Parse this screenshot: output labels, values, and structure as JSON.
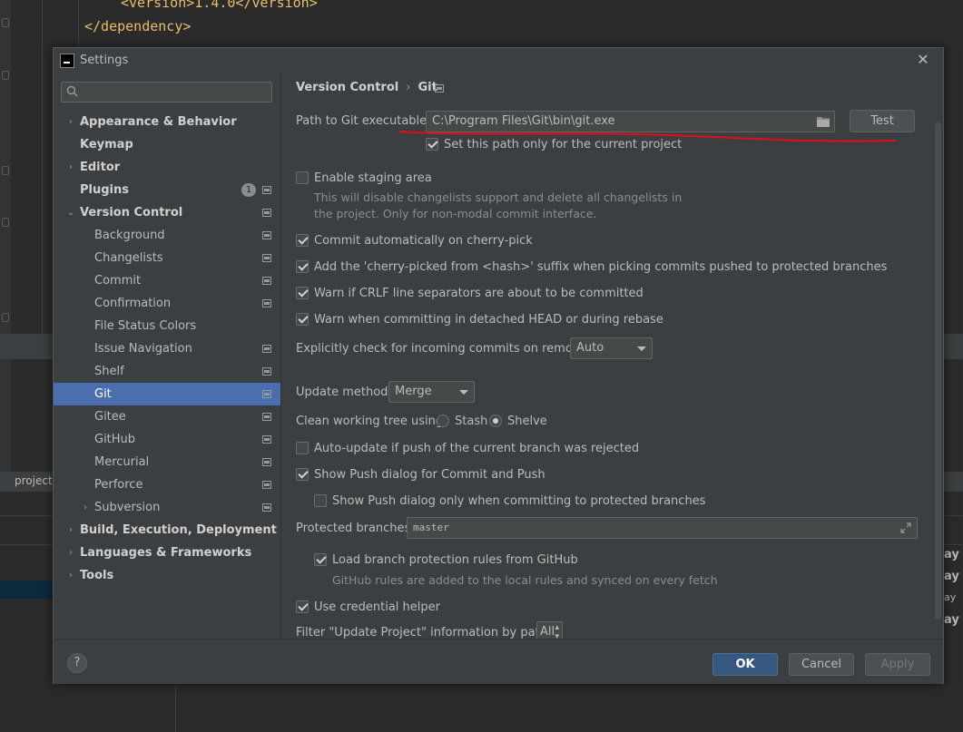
{
  "ide": {
    "code_line_1": "<version>1.4.0</version>",
    "code_line_2": "</dependency>",
    "project_tab": "project",
    "right_snippets": [
      "ay",
      "ay",
      "ay",
      "ay"
    ]
  },
  "dialog": {
    "title": "Settings",
    "close_glyph": "✕"
  },
  "sidebar": {
    "search_placeholder": "",
    "items": [
      {
        "label": "Appearance & Behavior",
        "level": "top",
        "arrow": "›"
      },
      {
        "label": "Keymap",
        "level": "top",
        "arrow": ""
      },
      {
        "label": "Editor",
        "level": "top",
        "arrow": "›"
      },
      {
        "label": "Plugins",
        "level": "top",
        "arrow": "",
        "badge": "1"
      },
      {
        "label": "Version Control",
        "level": "top",
        "arrow": "⌄"
      },
      {
        "label": "Background",
        "level": "sub"
      },
      {
        "label": "Changelists",
        "level": "sub"
      },
      {
        "label": "Commit",
        "level": "sub"
      },
      {
        "label": "Confirmation",
        "level": "sub"
      },
      {
        "label": "File Status Colors",
        "level": "sub"
      },
      {
        "label": "Issue Navigation",
        "level": "sub"
      },
      {
        "label": "Shelf",
        "level": "sub"
      },
      {
        "label": "Git",
        "level": "sub",
        "selected": true
      },
      {
        "label": "Gitee",
        "level": "sub"
      },
      {
        "label": "GitHub",
        "level": "sub"
      },
      {
        "label": "Mercurial",
        "level": "sub"
      },
      {
        "label": "Perforce",
        "level": "sub"
      },
      {
        "label": "Subversion",
        "level": "sub",
        "arrow": "›"
      },
      {
        "label": "Build, Execution, Deployment",
        "level": "top",
        "arrow": "›"
      },
      {
        "label": "Languages & Frameworks",
        "level": "top",
        "arrow": "›"
      },
      {
        "label": "Tools",
        "level": "top",
        "arrow": "›"
      }
    ]
  },
  "content": {
    "breadcrumb": {
      "parent": "Version Control",
      "separator": "›",
      "current": "Git"
    },
    "git_path": {
      "label": "Path to Git executable:",
      "value": "C:\\Program Files\\Git\\bin\\git.exe",
      "test_button": "Test",
      "current_project_only": {
        "label": "Set this path only for the current project",
        "checked": true
      }
    },
    "staging": {
      "label": "Enable staging area",
      "checked": false,
      "hint_line1": "This will disable changelists support and delete all changelists in",
      "hint_line2": "the project. Only for non-modal commit interface."
    },
    "cherry_pick_commit": {
      "label": "Commit automatically on cherry-pick",
      "checked": true
    },
    "cherry_pick_suffix": {
      "label": "Add the 'cherry-picked from <hash>' suffix when picking commits pushed to protected branches",
      "checked": true
    },
    "crlf_warn": {
      "label": "Warn if CRLF line separators are about to be committed",
      "checked": true
    },
    "detached_warn": {
      "label": "Warn when committing in detached HEAD or during rebase",
      "checked": true
    },
    "incoming_check": {
      "label": "Explicitly check for incoming commits on remotes:",
      "value": "Auto"
    },
    "update_method": {
      "label": "Update method:",
      "value": "Merge"
    },
    "clean_tree": {
      "label": "Clean working tree using:",
      "option1": "Stash",
      "option2": "Shelve",
      "selected": "Shelve"
    },
    "auto_update": {
      "label": "Auto-update if push of the current branch was rejected",
      "checked": false
    },
    "push_dialog": {
      "label": "Show Push dialog for Commit and Push",
      "checked": true
    },
    "push_dialog_protected": {
      "label": "Show Push dialog only when committing to protected branches",
      "checked": false
    },
    "protected_branches": {
      "label": "Protected branches:",
      "value": "master"
    },
    "github_rules": {
      "label": "Load branch protection rules from GitHub",
      "checked": true,
      "hint": "GitHub rules are added to the local rules and synced on every fetch"
    },
    "credential_helper": {
      "label": "Use credential helper",
      "checked": true
    },
    "filter_update": {
      "label": "Filter \"Update Project\" information by paths:",
      "value": "All"
    }
  },
  "footer": {
    "help": "?",
    "ok": "OK",
    "cancel": "Cancel",
    "apply": "Apply"
  },
  "colors": {
    "selection": "#4b6eaf",
    "annotation": "#e0101a"
  }
}
